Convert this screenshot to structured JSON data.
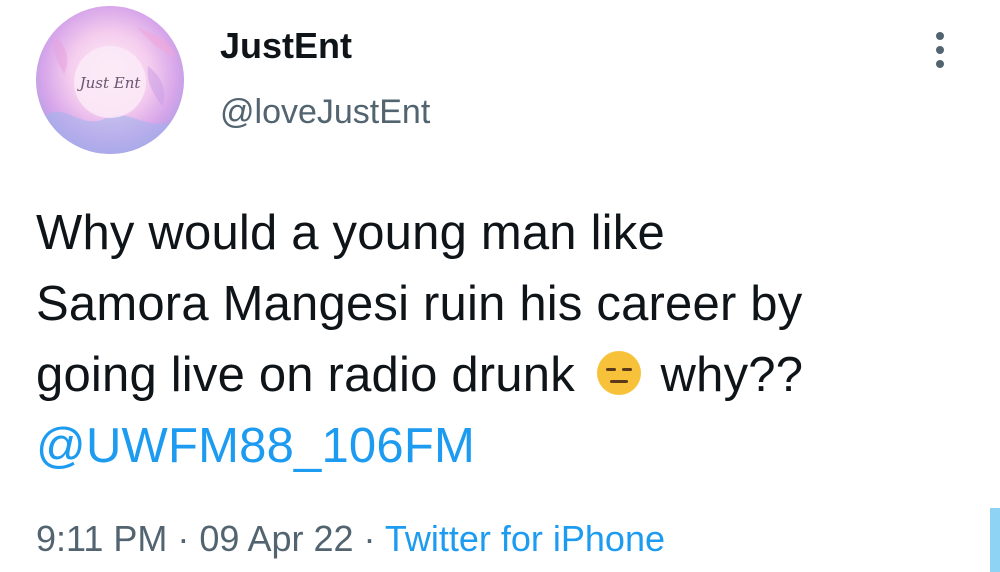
{
  "author": {
    "display_name": "JustEnt",
    "handle": "@loveJustEnt",
    "avatar_text": "Just Ent"
  },
  "tweet": {
    "line1": "Why would a young man like",
    "line2": "Samora Mangesi ruin his career by",
    "line3_before_emoji": "going live on radio drunk ",
    "line3_after_emoji": "why??",
    "emoji": "expressionless-face",
    "mention": "@UWFM88_106FM"
  },
  "meta": {
    "time": "9:11 PM",
    "separator": " · ",
    "date": "09 Apr 22",
    "source": "Twitter for iPhone"
  },
  "colors": {
    "link": "#1d9bf0",
    "secondary_text": "#536471",
    "primary_text": "#0f1419"
  }
}
